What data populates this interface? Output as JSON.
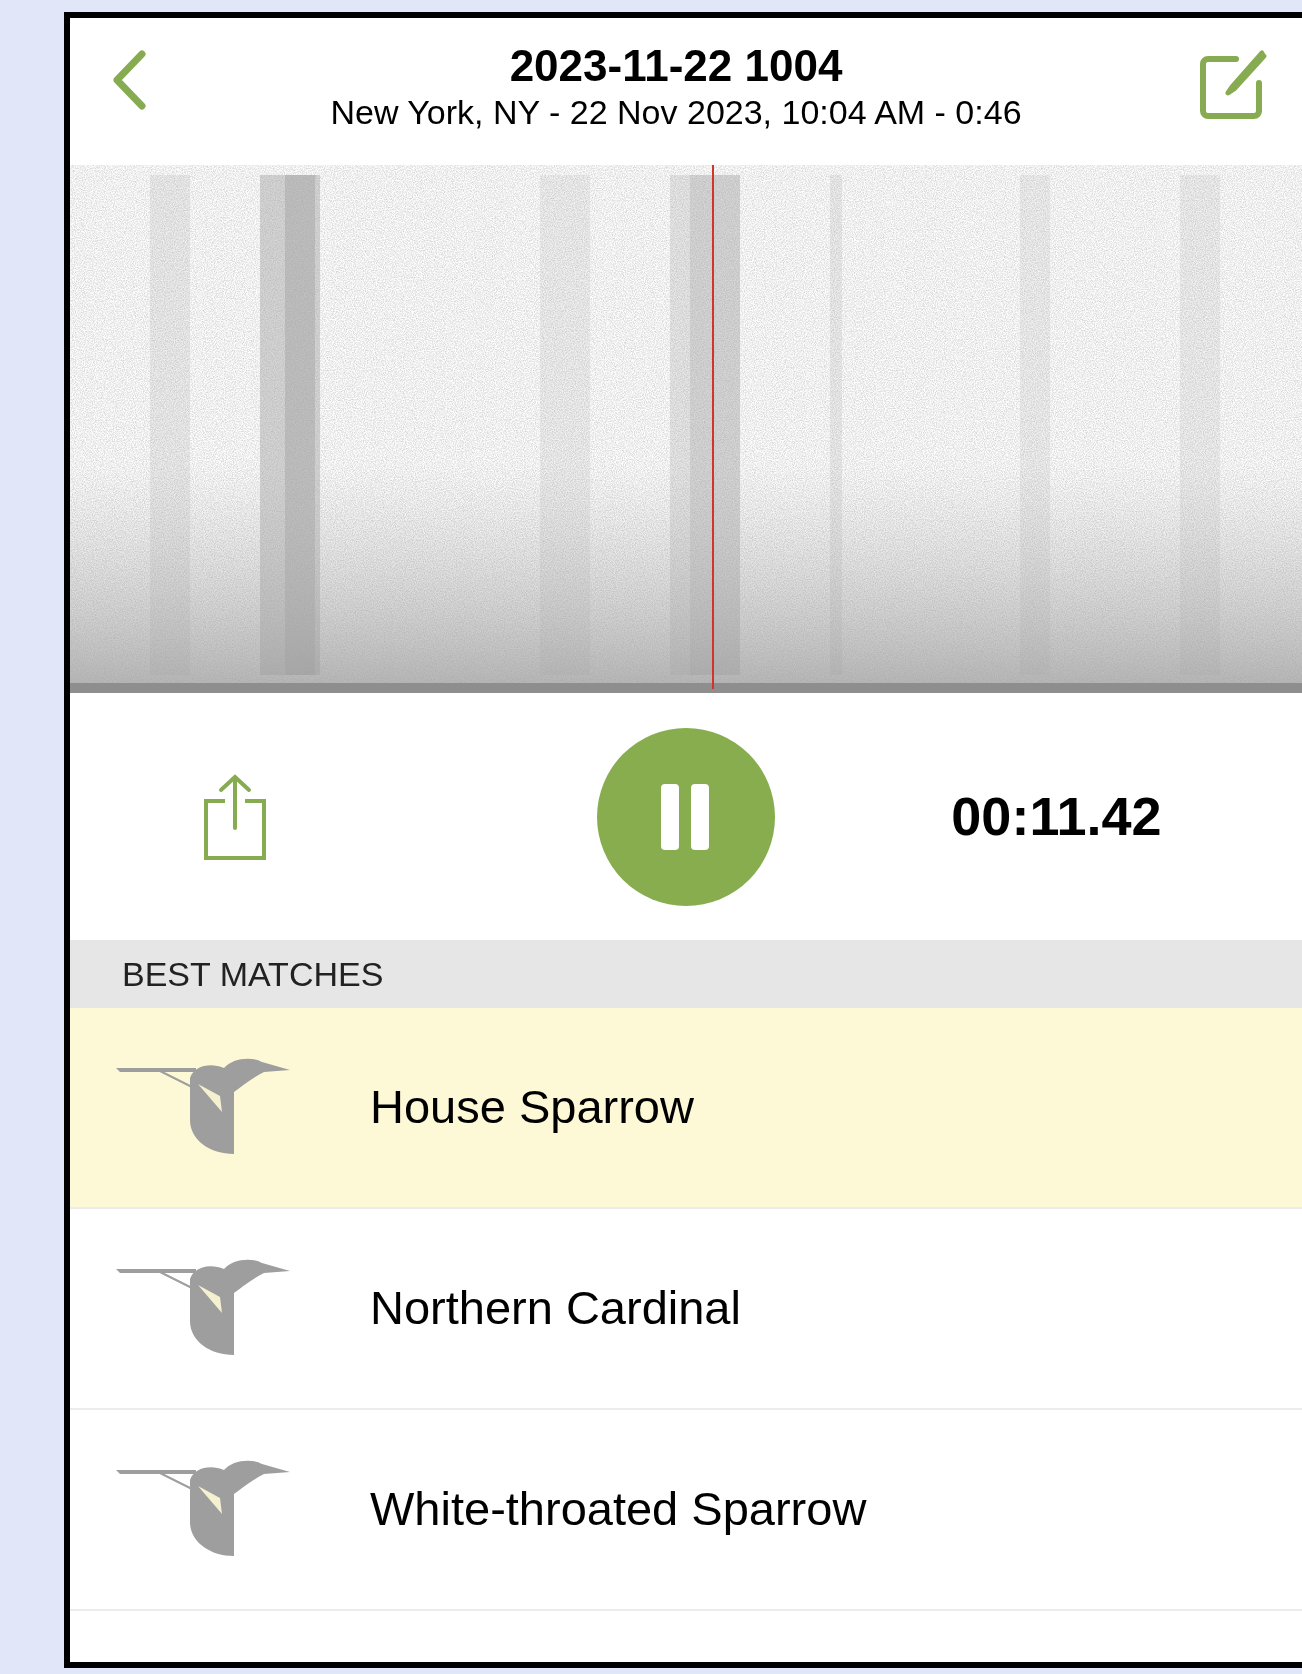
{
  "header": {
    "title": "2023-11-22 1004",
    "subtitle": "New York, NY - 22 Nov 2023, 10:04 AM - 0:46"
  },
  "player": {
    "playing": true,
    "time": "00:11.42"
  },
  "section": {
    "title": "BEST MATCHES"
  },
  "matches": [
    {
      "name": "House Sparrow",
      "selected": true
    },
    {
      "name": "Northern Cardinal",
      "selected": false
    },
    {
      "name": "White-throated Sparrow",
      "selected": false
    }
  ]
}
